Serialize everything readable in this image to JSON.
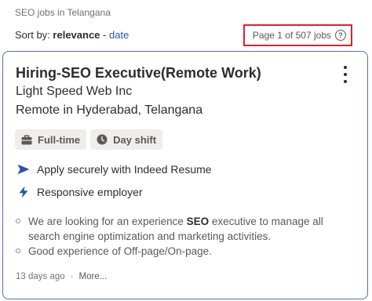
{
  "breadcrumb": "SEO jobs in Telangana",
  "sort": {
    "label": "Sort by:",
    "active": "relevance",
    "separator": "-",
    "alternate": "date"
  },
  "page_count": {
    "text": "Page 1 of 507 jobs",
    "help_icon": "question-circle-icon",
    "highlight_color": "#e0202a"
  },
  "job": {
    "title": "Hiring-SEO Executive(Remote Work)",
    "company": "Light Speed Web Inc",
    "location": "Remote in Hyderabad, Telangana",
    "tags": [
      {
        "icon": "briefcase-icon",
        "label": "Full-time"
      },
      {
        "icon": "clock-icon",
        "label": "Day shift"
      }
    ],
    "features": [
      {
        "icon": "send-arrow-icon",
        "label": "Apply securely with Indeed Resume"
      },
      {
        "icon": "lightning-icon",
        "label": "Responsive employer"
      }
    ],
    "snippet": [
      {
        "before": "We are looking for an experience ",
        "bold": "SEO",
        "after": " executive to manage all search engine optimization and marketing activities."
      },
      {
        "before": "Good experience of Off-page/On-page.",
        "bold": "",
        "after": ""
      }
    ],
    "posted": "13 days ago",
    "footer_separator": "·",
    "more_label": "More..."
  },
  "colors": {
    "link": "#2557a7",
    "card_border": "#4f6fb5",
    "tag_bg": "#f0eeec"
  }
}
